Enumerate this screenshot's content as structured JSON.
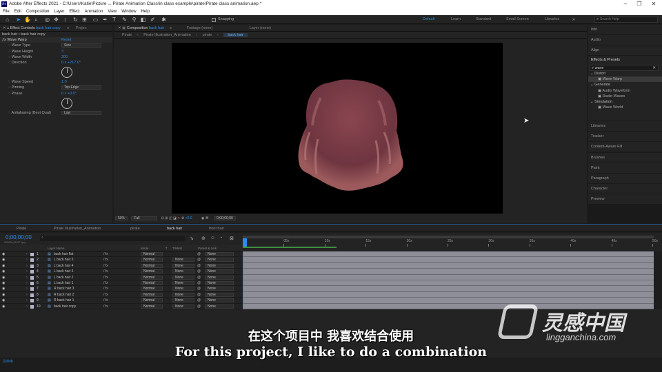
{
  "window": {
    "title": "Adobe After Effects 2021 - C:\\Users\\Katie\\Picture ... Pirate Animation Class\\in class example\\pirate\\Pirate class animation.aep *",
    "minimize": "–",
    "restore": "❐",
    "close": "✕"
  },
  "menu": [
    "File",
    "Edit",
    "Composition",
    "Layer",
    "Effect",
    "Animation",
    "View",
    "Window",
    "Help"
  ],
  "toolbar": {
    "snapping": "Snapping",
    "workspaces": [
      "Default",
      "Learn",
      "Standard",
      "Small Screen",
      "Libraries"
    ],
    "search_placeholder": "Search Help"
  },
  "effect_controls": {
    "tab": "Effect Controls",
    "tab_layer": "back hair copy",
    "tab2": "Projec",
    "subject": "back hair • back hair copy",
    "effect_name": "Wave Warp",
    "reset": "Reset",
    "props": [
      {
        "name": "Wave Type",
        "value": "Sine",
        "kind": "dropdown"
      },
      {
        "name": "Wave Height",
        "value": "3",
        "kind": "number"
      },
      {
        "name": "Wave Width",
        "value": "200",
        "kind": "number"
      },
      {
        "name": "Direction",
        "value": "0 x +217.0°",
        "kind": "angle"
      },
      {
        "name": "Wave Speed",
        "value": "1.0",
        "kind": "number"
      },
      {
        "name": "Pinning",
        "value": "Top Edge",
        "kind": "dropdown"
      },
      {
        "name": "Phase",
        "value": "0 x +0.0°",
        "kind": "angle"
      },
      {
        "name": "Antialiasing (Best Qual)",
        "value": "Low",
        "kind": "dropdown"
      }
    ]
  },
  "composition": {
    "tab": "Composition",
    "tab_name": "back hair",
    "footage": "Footage (none)",
    "layer": "Layer (none)",
    "breadcrumbs": [
      "Pirate",
      "Pirate Illustration_Animation",
      "pirate",
      "back hair"
    ],
    "zoom": "50%",
    "resolution": "Full",
    "exposure": "+0.0",
    "timecode": "0;00;00;00"
  },
  "right_panel": {
    "top_items": [
      "Info",
      "Audio",
      "Align"
    ],
    "effects_presets": {
      "title": "Effects & Presets",
      "search": "wave",
      "groups": [
        {
          "name": "Distort",
          "items": [
            "Wave Warp"
          ]
        },
        {
          "name": "Generate",
          "items": [
            "Audio Waveform",
            "Radio Waves"
          ]
        },
        {
          "name": "Simulation",
          "items": [
            "Wave World"
          ]
        }
      ]
    },
    "bottom_items": [
      "Libraries",
      "Tracker",
      "Content-Aware Fill",
      "Brushes",
      "Paint",
      "Paragraph",
      "Character",
      "Preview"
    ]
  },
  "timeline": {
    "tabs": [
      "Pirate",
      "Pirate Illustration_Animation",
      "pirate",
      "back hair",
      "front hair"
    ],
    "active_tab": "back hair",
    "timecode": "0;00;00;00",
    "fps": "00000 (29.97 fps)",
    "columns": {
      "layer_name": "Layer Name",
      "mode": "Mode",
      "t": "T",
      "trkmat": "TrkMat",
      "parent": "Parent & Link"
    },
    "ruler": [
      "0s",
      "05s",
      "10s",
      "15s",
      "20s",
      "25s",
      "30s",
      "35s",
      "40s",
      "45s",
      "50s"
    ],
    "layers": [
      {
        "num": "1",
        "name": "back hair flat",
        "mode": "Normal",
        "trkmat": "",
        "parent": "None"
      },
      {
        "num": "2",
        "name": "L back hair 5",
        "mode": "Normal",
        "trkmat": "None",
        "parent": "None"
      },
      {
        "num": "3",
        "name": "L back hair 4",
        "mode": "Normal",
        "trkmat": "None",
        "parent": "None"
      },
      {
        "num": "4",
        "name": "L back hair 3",
        "mode": "Normal",
        "trkmat": "None",
        "parent": "None"
      },
      {
        "num": "5",
        "name": "L back hair 2",
        "mode": "Normal",
        "trkmat": "None",
        "parent": "None"
      },
      {
        "num": "6",
        "name": "L back hair 1",
        "mode": "Normal",
        "trkmat": "None",
        "parent": "None"
      },
      {
        "num": "7",
        "name": "R back hair 3",
        "mode": "Normal",
        "trkmat": "None",
        "parent": "None"
      },
      {
        "num": "8",
        "name": "R back hair 2",
        "mode": "Normal",
        "trkmat": "None",
        "parent": "None"
      },
      {
        "num": "9",
        "name": "R back hair 1",
        "mode": "Normal",
        "trkmat": "None",
        "parent": "None"
      },
      {
        "num": "10",
        "name": "back hair copy",
        "mode": "Normal",
        "trkmat": "None",
        "parent": "None"
      }
    ]
  },
  "subtitles": {
    "cn": "在这个项目中 我喜欢结合使用",
    "en": "For this project, I like to do a combination"
  },
  "watermark": {
    "brand": "灵感中国",
    "url": "lingganchina.com"
  },
  "colors": {
    "accent": "#2d8ceb",
    "panel": "#232323",
    "hair": "#7a3d45",
    "track": "#8e8e98"
  }
}
